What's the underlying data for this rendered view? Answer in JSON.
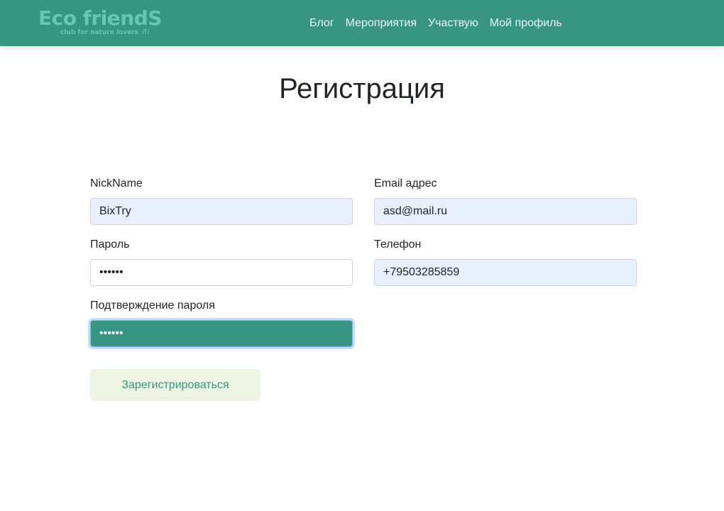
{
  "header": {
    "logo_title": "Eco friendS",
    "logo_tagline": "club for nature lovers",
    "nav": [
      "Блог",
      "Мероприятия",
      "Участвую",
      "Мой профиль"
    ]
  },
  "page": {
    "title": "Регистрация"
  },
  "form": {
    "nickname": {
      "label": "NickName",
      "value": "BixTry"
    },
    "email": {
      "label": "Email адрес",
      "value": "asd@mail.ru"
    },
    "password": {
      "label": "Пароль",
      "value": "••••••"
    },
    "phone": {
      "label": "Телефон",
      "value": "+79503285859"
    },
    "password_confirm": {
      "label": "Подтверждение пароля",
      "value": "••••••"
    },
    "submit_label": "Зарегистрироваться"
  },
  "colors": {
    "navbar": "#379582",
    "logo": "#66c7b3",
    "autofill": "#e8f0fe",
    "button_bg": "#edf4e1",
    "button_text": "#379582"
  }
}
